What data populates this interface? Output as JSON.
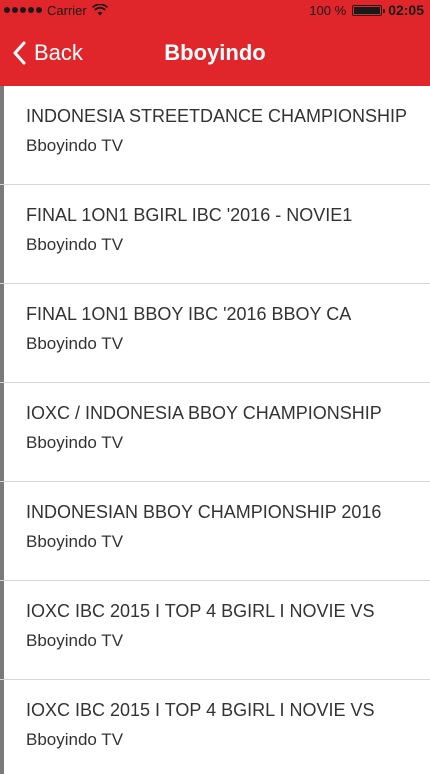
{
  "status": {
    "carrier": "Carrier",
    "battery": "100 %",
    "battery_fraction": 1.0,
    "time": "02:05"
  },
  "nav": {
    "back_label": "Back",
    "title": "Bboyindo"
  },
  "videos": [
    {
      "title": "INDONESIA STREETDANCE CHAMPIONSHIP",
      "channel": "Bboyindo TV"
    },
    {
      "title": "FINAL 1ON1 BGIRL IBC '2016 - NOVIE1",
      "channel": "Bboyindo TV"
    },
    {
      "title": "FINAL 1ON1 BBOY IBC '2016 BBOY CA",
      "channel": "Bboyindo TV"
    },
    {
      "title": "IOXC / INDONESIA BBOY CHAMPIONSHIP",
      "channel": "Bboyindo TV"
    },
    {
      "title": "INDONESIAN BBOY CHAMPIONSHIP 2016",
      "channel": "Bboyindo TV"
    },
    {
      "title": "IOXC IBC 2015 I TOP 4 BGIRL I NOVIE VS",
      "channel": "Bboyindo TV"
    },
    {
      "title": "IOXC IBC 2015 I TOP 4 BGIRL I NOVIE VS",
      "channel": "Bboyindo TV"
    }
  ],
  "colors": {
    "accent": "#e0262b"
  }
}
